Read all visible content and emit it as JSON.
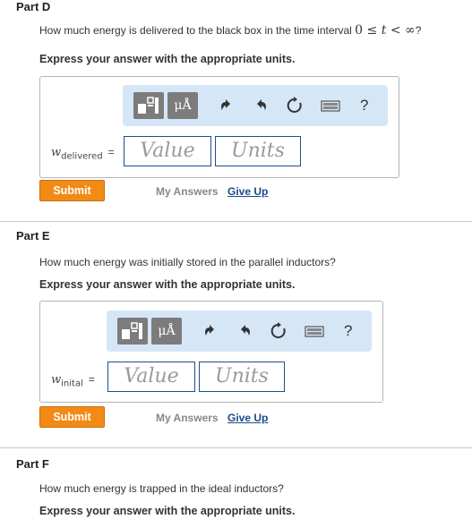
{
  "parts": [
    {
      "title": "Part D",
      "question_prefix": "How much energy is delivered to the black box in the time interval ",
      "question_math": [
        "0",
        "≤",
        "t",
        "<",
        "∞"
      ],
      "question_suffix": "?",
      "instruction": "Express your answer with the appropriate units.",
      "var_symbol": "w",
      "var_subscript": "delivered",
      "equals": "=",
      "value_placeholder": "Value",
      "units_placeholder": "Units",
      "submit_label": "Submit",
      "my_answers_label": "My Answers",
      "give_up_label": "Give Up"
    },
    {
      "title": "Part E",
      "question": "How much energy was initially stored in the parallel inductors?",
      "instruction": "Express your answer with the appropriate units.",
      "var_symbol": "w",
      "var_subscript": "inital",
      "equals": "=",
      "value_placeholder": "Value",
      "units_placeholder": "Units",
      "submit_label": "Submit",
      "my_answers_label": "My Answers",
      "give_up_label": "Give Up"
    },
    {
      "title": "Part F",
      "question": "How much energy is trapped in the ideal inductors?",
      "instruction": "Express your answer with the appropriate units."
    }
  ],
  "toolbar": {
    "units_button_label": "μÅ",
    "help_label": "?",
    "icons": [
      "templates-icon",
      "units-icon",
      "undo-icon",
      "redo-icon",
      "reset-icon",
      "keyboard-icon",
      "help-icon"
    ]
  },
  "colors": {
    "submit": "#f28a16",
    "toolbar_bg": "#d5e6f7",
    "field_border": "#1c4f8c",
    "link": "#1a4a8a"
  }
}
